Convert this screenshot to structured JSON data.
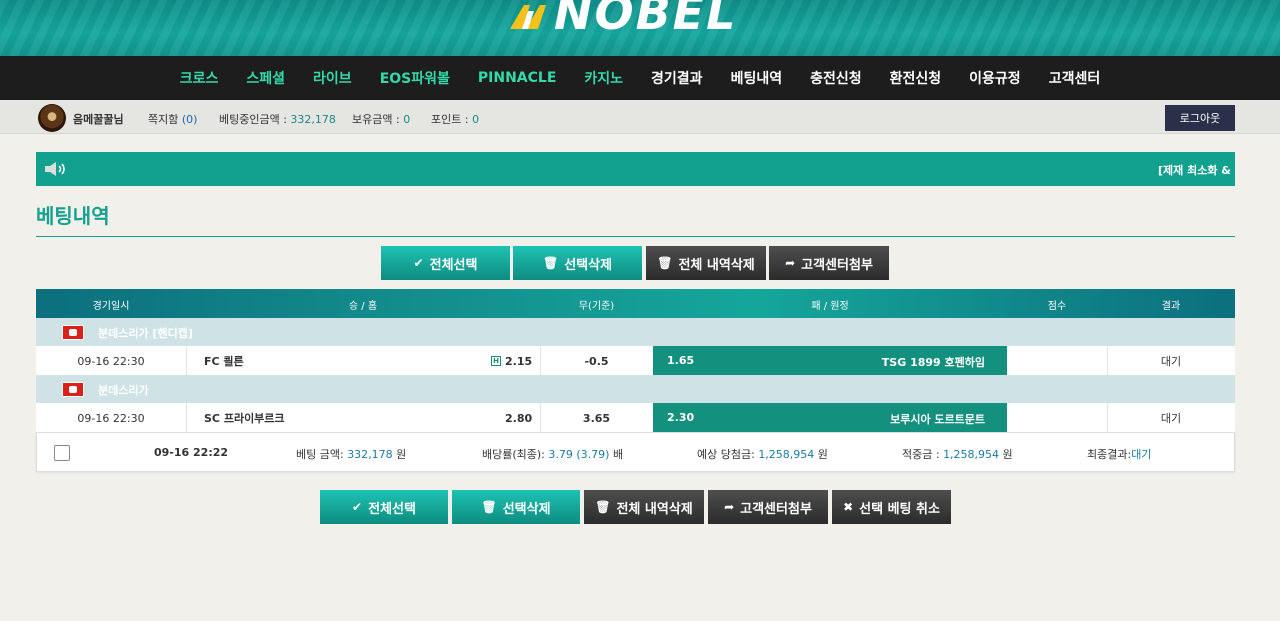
{
  "brand": {
    "logo_text": "NOBEL"
  },
  "nav": [
    {
      "label": "크로스",
      "style": "green"
    },
    {
      "label": "스페셜",
      "style": "green"
    },
    {
      "label": "라이브",
      "style": "green"
    },
    {
      "label": "EOS파워볼",
      "style": "green"
    },
    {
      "label": "PINNACLE",
      "style": "green"
    },
    {
      "label": "카지노",
      "style": "green"
    },
    {
      "label": "경기결과",
      "style": "white"
    },
    {
      "label": "베팅내역",
      "style": "white"
    },
    {
      "label": "충전신청",
      "style": "white"
    },
    {
      "label": "환전신청",
      "style": "white"
    },
    {
      "label": "이용규정",
      "style": "white"
    },
    {
      "label": "고객센터",
      "style": "white"
    }
  ],
  "user": {
    "name": "음메꿀꿀님",
    "notes_label": "쪽지함 ",
    "notes_count": "(0)",
    "betting_label": "베팅중인금액 : ",
    "betting_value": "332,178",
    "balance_label": "보유금액 : ",
    "balance_value": "0",
    "points_label": "포인트 : ",
    "points_value": "0",
    "logout": "로그아웃"
  },
  "notice": {
    "text": "[제재 최소화 &"
  },
  "page_title": "베팅내역",
  "buttons_top": {
    "select_all": "전체선택",
    "delete_selected": "선택삭제",
    "delete_all": "전체 내역삭제",
    "attach_cs": "고객센터첨부"
  },
  "table": {
    "headers": {
      "date": "경기일시",
      "home": "승 / 홈",
      "draw": "무(기준)",
      "away": "패 / 원정",
      "score": "점수",
      "result": "결과"
    },
    "games": [
      {
        "league": "분데스리가 [핸디캡]",
        "date": "09-16 22:30",
        "home": "FC 쾰른",
        "home_marker": "H",
        "home_odds": "2.15",
        "draw": "-0.5",
        "away_odds": "1.65",
        "away": "TSG 1899 호펜하임",
        "score": "",
        "result": "대기"
      },
      {
        "league": "분데스리가",
        "date": "09-16 22:30",
        "home": "SC 프라이부르크",
        "home_marker": "",
        "home_odds": "2.80",
        "draw": "3.65",
        "away_odds": "2.30",
        "away": "보루시아 도르트문트",
        "score": "",
        "result": "대기"
      }
    ]
  },
  "summary": {
    "bet_time": "09-16 22:22",
    "bet_amount_label": "베팅 금액: ",
    "bet_amount_value": "332,178",
    "bet_amount_unit": " 원",
    "odds_label": "배당률(최종): ",
    "odds_value": "3.79 (3.79)",
    "odds_unit": " 배",
    "expected_label": "예상 당첨금: ",
    "expected_value": "1,258,954",
    "expected_unit": " 원",
    "hit_label": "적중금 : ",
    "hit_value": "1,258,954",
    "hit_unit": " 원",
    "final_label": "최종결과:",
    "final_value": "대기"
  },
  "buttons_bottom": {
    "select_all": "전체선택",
    "delete_selected": "선택삭제",
    "delete_all": "전체 내역삭제",
    "attach_cs": "고객센터첨부",
    "cancel_bet": "선택 베팅 취소"
  },
  "colors": {
    "accent": "#15a090",
    "nav_green": "#33d9a8",
    "header_dark": "#1d1d1d",
    "away_cell": "#14907f"
  }
}
